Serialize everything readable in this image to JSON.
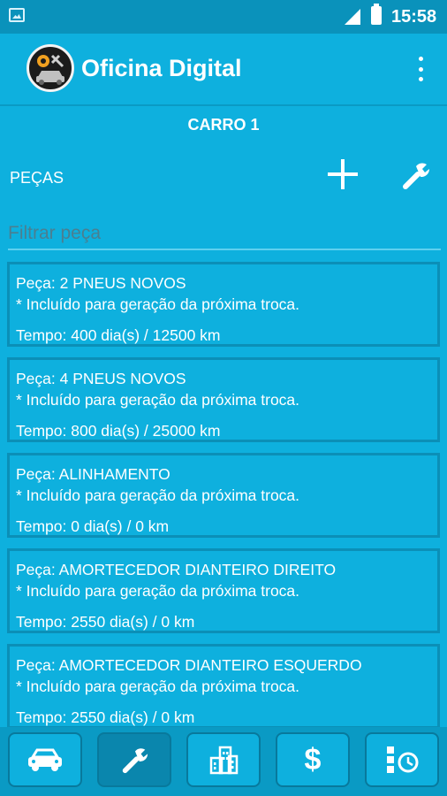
{
  "status_bar": {
    "time": "15:58",
    "left_icon": "image-icon",
    "signal_icon": "signal-icon",
    "battery_icon": "battery-charging-icon"
  },
  "app_bar": {
    "title": "Oficina Digital",
    "logo_icon": "car-service-logo-icon",
    "menu_icon": "more-vert-icon"
  },
  "car": {
    "title": "CARRO 1"
  },
  "section": {
    "label": "PEÇAS",
    "add_icon": "add-icon",
    "tools_icon": "wrench-icon"
  },
  "filter": {
    "placeholder": "Filtrar peça",
    "value": ""
  },
  "parts": [
    {
      "name": "Peça: 2 PNEUS NOVOS",
      "note": "* Incluído para geração da próxima troca.",
      "time": "Tempo: 400 dia(s) / 12500 km"
    },
    {
      "name": "Peça: 4 PNEUS NOVOS",
      "note": "* Incluído para geração da próxima troca.",
      "time": "Tempo: 800 dia(s) / 25000 km"
    },
    {
      "name": "Peça: ALINHAMENTO",
      "note": "* Incluído para geração da próxima troca.",
      "time": "Tempo: 0 dia(s) / 0 km"
    },
    {
      "name": "Peça: AMORTECEDOR DIANTEIRO DIREITO",
      "note": "* Incluído para geração da próxima troca.",
      "time": "Tempo: 2550 dia(s) / 0 km"
    },
    {
      "name": "Peça: AMORTECEDOR DIANTEIRO ESQUERDO",
      "note": "* Incluído para geração da próxima troca.",
      "time": "Tempo: 2550 dia(s) / 0 km"
    }
  ],
  "bottom_nav": {
    "items": [
      {
        "icon": "car-icon",
        "active": false
      },
      {
        "icon": "wrench-icon",
        "active": true
      },
      {
        "icon": "buildings-icon",
        "active": false
      },
      {
        "icon": "dollar-icon",
        "label": "$",
        "active": false
      },
      {
        "icon": "schedule-icon",
        "active": false
      }
    ]
  },
  "colors": {
    "background": "#0eb0de",
    "status_bar": "#0a92bb",
    "card_border": "#0b8fb7",
    "nav_active": "#0a86ad",
    "text": "#ffffff"
  }
}
